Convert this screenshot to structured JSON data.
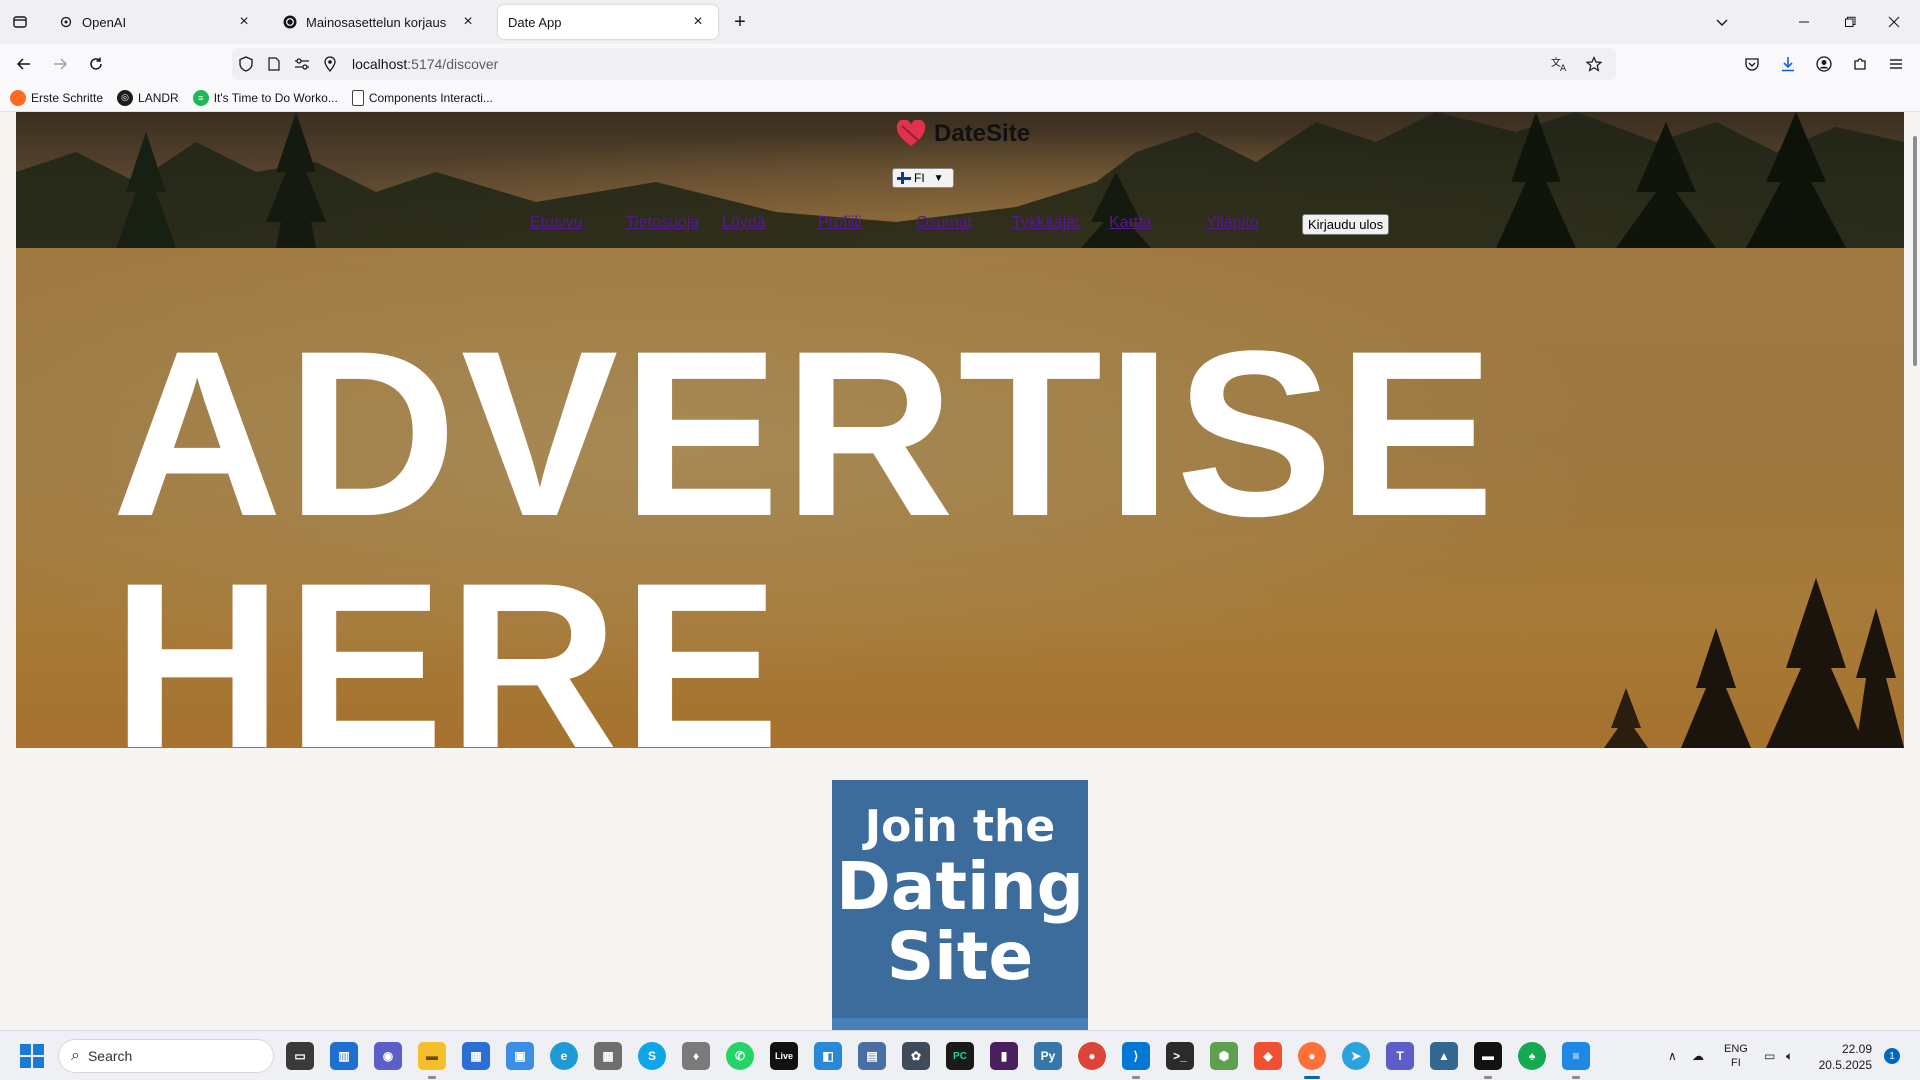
{
  "browser": {
    "tabs": [
      {
        "title": "OpenAI",
        "icon": "openai-icon",
        "active": false
      },
      {
        "title": "Mainosasettelun korjaus",
        "icon": "chatgpt-icon",
        "active": false
      },
      {
        "title": "Date App",
        "icon": "",
        "active": true
      }
    ],
    "url_host": "localhost",
    "url_path": ":5174/discover",
    "bookmarks": [
      {
        "label": "Erste Schritte",
        "icon": "firefox-icon",
        "color": "#ff6a1f"
      },
      {
        "label": "LANDR",
        "icon": "landr-icon",
        "color": "#1c1c1c"
      },
      {
        "label": "It's Time to Do Worko...",
        "icon": "spotify-icon",
        "color": "#1db954"
      },
      {
        "label": "Components Interacti...",
        "icon": "page-icon",
        "color": "#444444"
      }
    ]
  },
  "site": {
    "brand": "DateSite",
    "language": "FI",
    "nav": [
      {
        "label": "Etusivu"
      },
      {
        "label": "Tietosuoja"
      },
      {
        "label": "Löydä"
      },
      {
        "label": "Profiili"
      },
      {
        "label": "Osumat"
      },
      {
        "label": "Tykkääjät"
      },
      {
        "label": "Kartta"
      },
      {
        "label": "Ylläpito"
      }
    ],
    "logout": "Kirjaudu ulos",
    "ad": {
      "line1": "ADVERTISE",
      "line2": "HERE"
    },
    "join_card": {
      "line1": "Join the",
      "line2": "Dating",
      "line3": "Site"
    }
  },
  "taskbar": {
    "search_placeholder": "Search",
    "language": {
      "top": "ENG",
      "bottom": "FI"
    },
    "time": "22.09",
    "date": "20.5.2025",
    "notifications": "1"
  },
  "colors": {
    "accent": "#0067c0",
    "link": "#551a8b",
    "card": "#3c6c9c",
    "heart": "#e2304f"
  }
}
